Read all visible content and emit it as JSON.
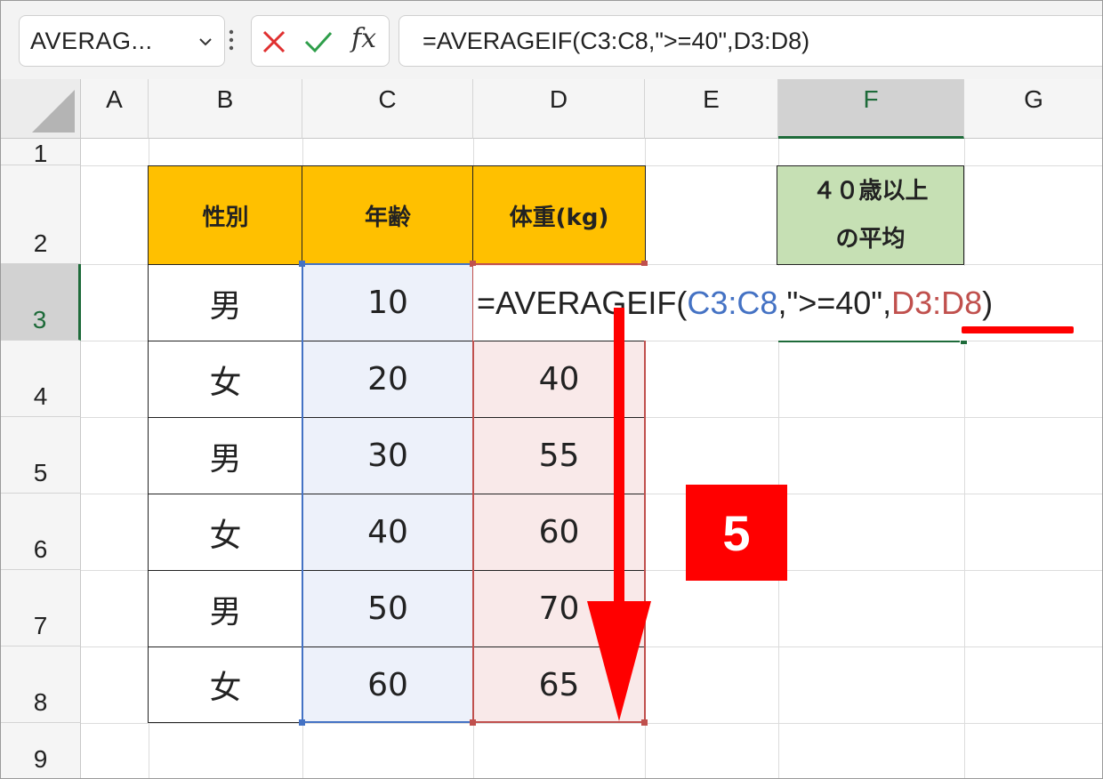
{
  "formula_bar": {
    "name_box": "AVERAG...",
    "fx_label": "fx",
    "formula": "=AVERAGEIF(C3:C8,\">=40\",D3:D8)"
  },
  "columns": [
    "A",
    "B",
    "C",
    "D",
    "E",
    "F",
    "G"
  ],
  "rows": [
    "1",
    "2",
    "3",
    "4",
    "5",
    "6",
    "7",
    "8",
    "9"
  ],
  "table": {
    "headers": [
      "性別",
      "年齢",
      "体重(kg)"
    ],
    "data": [
      [
        "男",
        "10",
        ""
      ],
      [
        "女",
        "20",
        "40"
      ],
      [
        "男",
        "30",
        "55"
      ],
      [
        "女",
        "40",
        "60"
      ],
      [
        "男",
        "50",
        "70"
      ],
      [
        "女",
        "60",
        "65"
      ]
    ]
  },
  "result_label": {
    "line1": "４０歳以上",
    "line2": "の平均"
  },
  "formula_edit": {
    "prefix": "=AVERAGEIF(",
    "range1": "C3:C8",
    "middle": ",\">=40\",",
    "range2": "D3:D8",
    "suffix": ")"
  },
  "step_badge": "5",
  "colors": {
    "header_fill": "#ffc000",
    "result_fill": "#c6e0b4",
    "range1_color": "#4472c4",
    "range2_color": "#c0504d",
    "annotation": "#ff0000",
    "selected_header": "#1e6b3a"
  },
  "icons": [
    "chevron-down-icon",
    "more-vertical-icon",
    "cancel-icon",
    "enter-check-icon",
    "insert-function-icon",
    "select-all-icon",
    "down-arrow-icon"
  ]
}
